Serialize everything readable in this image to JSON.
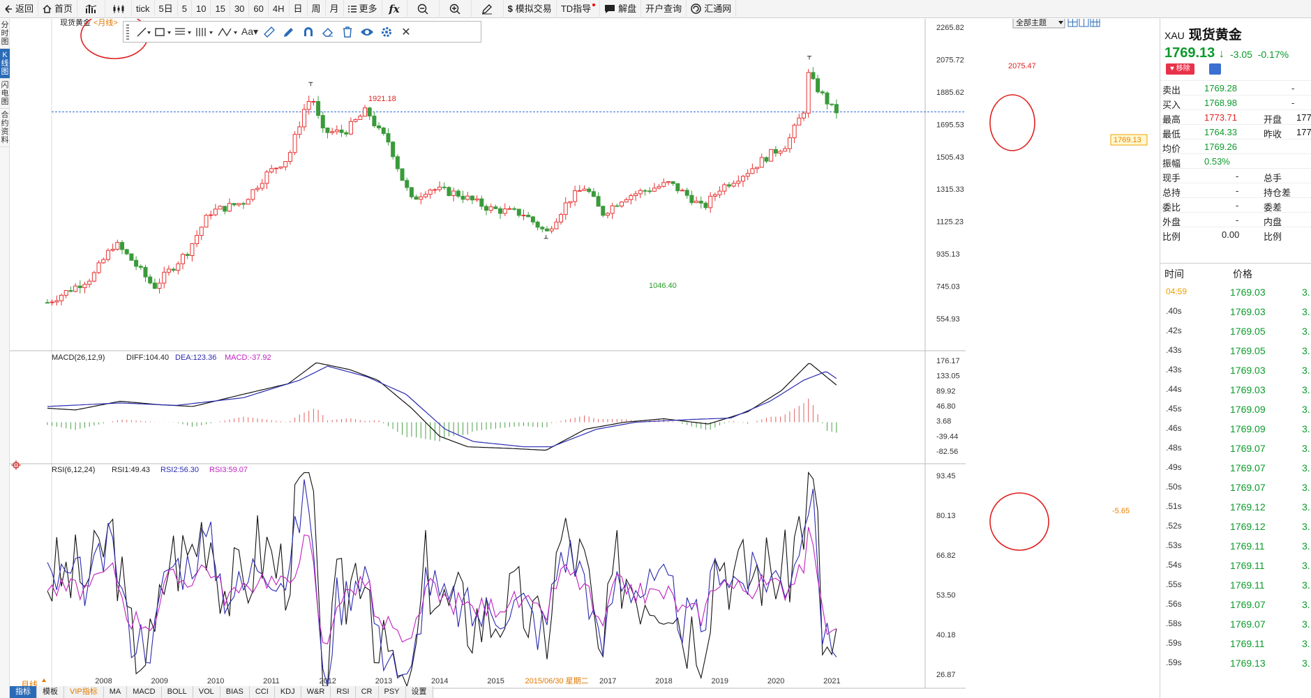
{
  "toolbar": {
    "back": "返回",
    "home": "首页",
    "periods": [
      "tick",
      "5日",
      "5",
      "10",
      "15",
      "30",
      "60",
      "4H",
      "日",
      "周",
      "月"
    ],
    "more": "更多",
    "sim_trade": "模拟交易",
    "td_guide": "TD指导",
    "analysis": "解盘",
    "open_account": "开户查询",
    "fxnet": "汇通网"
  },
  "left_tabs": [
    "分时图",
    "K线图",
    "闪电图",
    "合约资料"
  ],
  "chart": {
    "instrument": "现货黄金",
    "period_label": "<月线>",
    "theme_button": "全部主题",
    "price_ticks": [
      "2265.82",
      "2075.72",
      "1885.62",
      "1695.53",
      "1505.43",
      "1315.33",
      "1125.23",
      "935.13",
      "745.03",
      "554.93"
    ],
    "current_price_tag": "1769.13",
    "high_label": "2075.47",
    "high_label_2011": "1921.18",
    "low_label": "1046.40",
    "macd_header": "MACD(26,12,9)",
    "macd_diff": "DIFF:104.40",
    "macd_dea": "DEA:123.36",
    "macd_macd": "MACD:-37.92",
    "macd_ticks": [
      "176.17",
      "133.05",
      "89.92",
      "46.80",
      "3.68",
      "-39.44",
      "-82.56"
    ],
    "macd_current": "-5.65",
    "rsi_header": "RSI(6,12,24)",
    "rsi_1": "RSI1:49.43",
    "rsi_2": "RSI2:56.30",
    "rsi_3": "RSI3:59.07",
    "rsi_ticks": [
      "93.45",
      "80.13",
      "66.82",
      "53.50",
      "40.18",
      "26.87"
    ],
    "period_footer": "月线",
    "x_labels": [
      "2008",
      "2009",
      "2010",
      "2011",
      "2012",
      "2013",
      "2014",
      "2015",
      "2015/06/30 星期二",
      "2017",
      "2018",
      "2019",
      "2020",
      "2021"
    ],
    "colors": {
      "up": "#e83030",
      "down": "#3a9a3a",
      "diff": "#111111",
      "dea": "#2a2ab0",
      "rsi3": "#c020c0",
      "annot": "#e02020"
    }
  },
  "quote": {
    "code": "XAU",
    "name": "现货黄金",
    "price": "1769.13",
    "arrow": "↓",
    "change": "-3.05",
    "change_pct": "-0.17%",
    "remove_btn": "移除",
    "rows": [
      {
        "l1": "卖出",
        "v1": "1769.28",
        "l2": "-",
        "v2": ""
      },
      {
        "l1": "买入",
        "v1": "1768.98",
        "l2": "-",
        "v2": ""
      },
      {
        "l1": "最高",
        "v1": "1773.71",
        "l2": "开盘",
        "v2": "177"
      },
      {
        "l1": "最低",
        "v1": "1764.33",
        "l2": "昨收",
        "v2": "177"
      },
      {
        "l1": "均价",
        "v1": "1769.26",
        "l2": "",
        "v2": ""
      },
      {
        "l1": "振幅",
        "v1": "0.53%",
        "l2": "",
        "v2": ""
      },
      {
        "l1": "现手",
        "v1": "-",
        "l2": "总手",
        "v2": ""
      },
      {
        "l1": "总持",
        "v1": "-",
        "l2": "持仓差",
        "v2": ""
      },
      {
        "l1": "委比",
        "v1": "-",
        "l2": "委差",
        "v2": ""
      },
      {
        "l1": "外盘",
        "v1": "-",
        "l2": "内盘",
        "v2": ""
      },
      {
        "l1": "比例",
        "v1": "0.00",
        "l2": "比例",
        "v2": ""
      }
    ],
    "ticks_header": {
      "time": "时间",
      "price": "价格"
    },
    "ticks": [
      {
        "t": "04:59",
        "p": "1769.03",
        "v": "3."
      },
      {
        "t": ".40s",
        "p": "1769.03",
        "v": "3."
      },
      {
        "t": ".42s",
        "p": "1769.05",
        "v": "3."
      },
      {
        "t": ".43s",
        "p": "1769.05",
        "v": "3."
      },
      {
        "t": ".43s",
        "p": "1769.03",
        "v": "3."
      },
      {
        "t": ".44s",
        "p": "1769.03",
        "v": "3."
      },
      {
        "t": ".45s",
        "p": "1769.09",
        "v": "3."
      },
      {
        "t": ".46s",
        "p": "1769.09",
        "v": "3."
      },
      {
        "t": ".48s",
        "p": "1769.07",
        "v": "3."
      },
      {
        "t": ".49s",
        "p": "1769.07",
        "v": "3."
      },
      {
        "t": ".50s",
        "p": "1769.07",
        "v": "3."
      },
      {
        "t": ".51s",
        "p": "1769.12",
        "v": "3."
      },
      {
        "t": ".52s",
        "p": "1769.12",
        "v": "3."
      },
      {
        "t": ".53s",
        "p": "1769.11",
        "v": "3."
      },
      {
        "t": ".54s",
        "p": "1769.11",
        "v": "3."
      },
      {
        "t": ".55s",
        "p": "1769.11",
        "v": "3."
      },
      {
        "t": ".56s",
        "p": "1769.07",
        "v": "3."
      },
      {
        "t": ".58s",
        "p": "1769.07",
        "v": "3."
      },
      {
        "t": ".59s",
        "p": "1769.11",
        "v": "3."
      },
      {
        "t": ".59s",
        "p": "1769.13",
        "v": "3."
      }
    ]
  },
  "bottom_tabs": [
    "指标",
    "模板",
    "VIP指标",
    "MA",
    "MACD",
    "BOLL",
    "VOL",
    "BIAS",
    "CCI",
    "KDJ",
    "W&R",
    "RSI",
    "CR",
    "PSY",
    "设置"
  ],
  "chart_data": {
    "type": "candlestick",
    "title": "现货黄金 <月线>",
    "x_range": [
      "2007",
      "2021"
    ],
    "ylim": [
      554.93,
      2265.82
    ],
    "close_path": [
      [
        2007.0,
        650
      ],
      [
        2007.8,
        800
      ],
      [
        2008.2,
        1000
      ],
      [
        2008.5,
        900
      ],
      [
        2008.9,
        740
      ],
      [
        2009.5,
        950
      ],
      [
        2009.9,
        1180
      ],
      [
        2010.5,
        1240
      ],
      [
        2010.9,
        1400
      ],
      [
        2011.3,
        1500
      ],
      [
        2011.7,
        1900
      ],
      [
        2011.9,
        1650
      ],
      [
        2012.3,
        1650
      ],
      [
        2012.7,
        1780
      ],
      [
        2012.9,
        1660
      ],
      [
        2013.1,
        1590
      ],
      [
        2013.3,
        1400
      ],
      [
        2013.5,
        1250
      ],
      [
        2013.8,
        1320
      ],
      [
        2014.3,
        1290
      ],
      [
        2014.9,
        1200
      ],
      [
        2015.5,
        1170
      ],
      [
        2015.9,
        1060
      ],
      [
        2016.3,
        1250
      ],
      [
        2016.6,
        1330
      ],
      [
        2016.9,
        1170
      ],
      [
        2017.3,
        1270
      ],
      [
        2017.8,
        1320
      ],
      [
        2018.1,
        1350
      ],
      [
        2018.5,
        1260
      ],
      [
        2018.7,
        1200
      ],
      [
        2019.0,
        1320
      ],
      [
        2019.5,
        1420
      ],
      [
        2019.9,
        1520
      ],
      [
        2020.2,
        1580
      ],
      [
        2020.5,
        1780
      ],
      [
        2020.6,
        1970
      ],
      [
        2020.8,
        1880
      ],
      [
        2021.0,
        1790
      ],
      [
        2021.1,
        1769
      ]
    ],
    "annotations": {
      "high": 2075.47,
      "high_2011": 1921.18,
      "low": 1046.4,
      "last": 1769.13
    },
    "macd": {
      "diff": 104.4,
      "dea": 123.36,
      "macd": -37.92,
      "ylim": [
        -82.56,
        176.17
      ]
    },
    "rsi": {
      "rsi1": 49.43,
      "rsi2": 56.3,
      "rsi3": 59.07,
      "ylim": [
        26.87,
        93.45
      ]
    }
  }
}
